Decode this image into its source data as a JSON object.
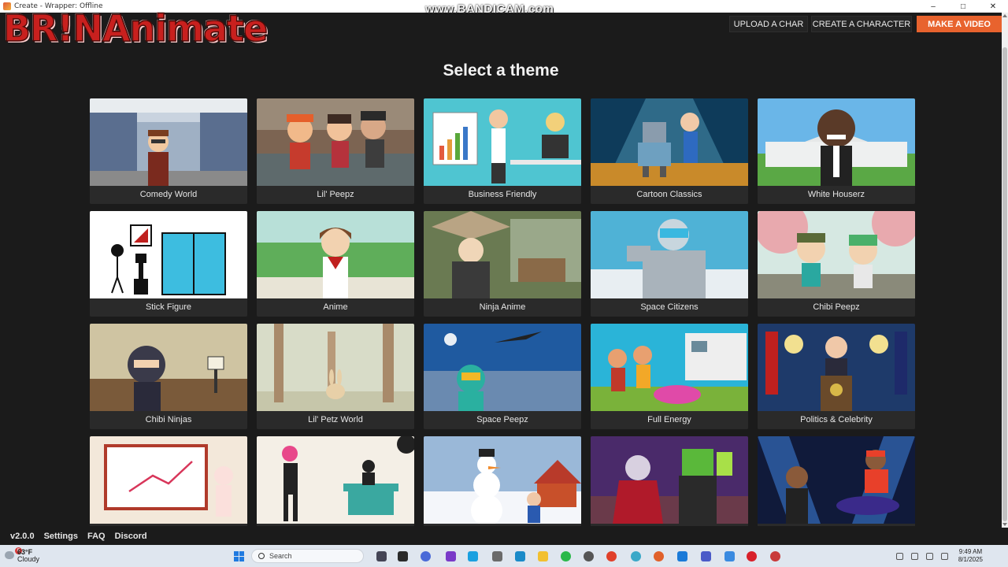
{
  "window": {
    "title": "Create - Wrapper: Offline",
    "controls": [
      "–",
      "□",
      "✕"
    ]
  },
  "overlay": {
    "watermark": "www.BANDICAM.com",
    "brand": "BR!NAnimate"
  },
  "header": {
    "upload_label": "UPLOAD A CHAR",
    "create_label": "CREATE A CHARACTER",
    "make_label": "MAKE A VIDEO",
    "accent": "#e8632e"
  },
  "main": {
    "title": "Select a theme",
    "themes": [
      {
        "label": "Comedy World"
      },
      {
        "label": "Lil' Peepz"
      },
      {
        "label": "Business Friendly"
      },
      {
        "label": "Cartoon Classics"
      },
      {
        "label": "White Houserz"
      },
      {
        "label": "Stick Figure"
      },
      {
        "label": "Anime"
      },
      {
        "label": "Ninja Anime"
      },
      {
        "label": "Space Citizens"
      },
      {
        "label": "Chibi Peepz"
      },
      {
        "label": "Chibi Ninjas"
      },
      {
        "label": "Lil' Petz World"
      },
      {
        "label": "Space Peepz"
      },
      {
        "label": "Full Energy"
      },
      {
        "label": "Politics & Celebrity"
      },
      {
        "label": ""
      },
      {
        "label": ""
      },
      {
        "label": ""
      },
      {
        "label": ""
      },
      {
        "label": ""
      }
    ]
  },
  "footer": {
    "version": "v2.0.0",
    "settings": "Settings",
    "faq": "FAQ",
    "discord": "Discord"
  },
  "taskbar": {
    "weather_temp": "63°F",
    "weather_desc": "Cloudy",
    "weather_badge": "6",
    "search_placeholder": "Search",
    "time": "9:49 AM",
    "date": "8/1/2025"
  }
}
